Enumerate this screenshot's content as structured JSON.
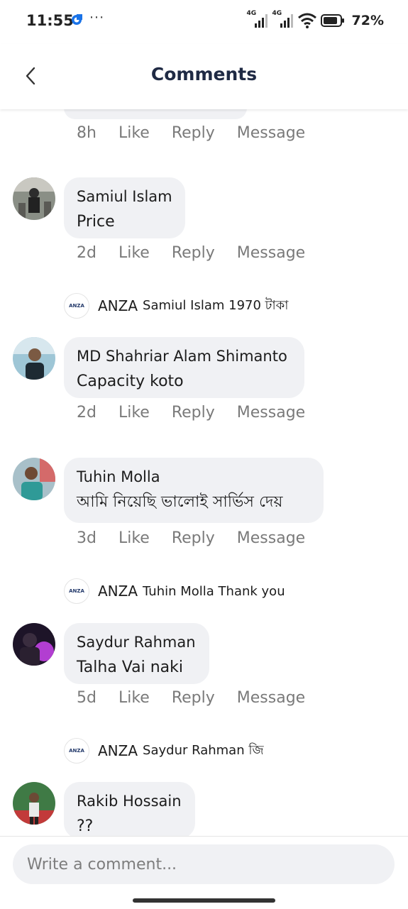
{
  "status_bar": {
    "time": "11:55",
    "dots": "···",
    "net1": "4G",
    "net2": "4G",
    "battery": "72%"
  },
  "header": {
    "title": "Comments"
  },
  "first_comment_meta": {
    "time": "8h",
    "like": "Like",
    "reply": "Reply",
    "message": "Message"
  },
  "comments": [
    {
      "name": "Samiul Islam",
      "text": "Price",
      "time": "2d",
      "like": "Like",
      "reply": "Reply",
      "message": "Message",
      "page_reply": {
        "page": "ANZA",
        "text": "Samiul Islam 1970 টাকা"
      }
    },
    {
      "name": "MD Shahriar Alam Shimanto",
      "text": "Capacity koto",
      "time": "2d",
      "like": "Like",
      "reply": "Reply",
      "message": "Message"
    },
    {
      "name": "Tuhin Molla",
      "text": "আমি নিয়েছি ভালোই সার্ভিস দেয়",
      "time": "3d",
      "like": "Like",
      "reply": "Reply",
      "message": "Message",
      "page_reply": {
        "page": "ANZA",
        "text": "Tuhin Molla Thank you"
      }
    },
    {
      "name": "Saydur Rahman",
      "text": "Talha Vai naki",
      "time": "5d",
      "like": "Like",
      "reply": "Reply",
      "message": "Message",
      "page_reply": {
        "page": "ANZA",
        "text": "Saydur Rahman জি"
      }
    },
    {
      "name": "Rakib Hossain",
      "text": "??"
    }
  ],
  "page_logo_text": "ANZA",
  "composer": {
    "placeholder": "Write a comment..."
  },
  "colors": {
    "bubble": "#f0f1f4",
    "meta_text": "#7a7a7a",
    "title": "#1f2a44",
    "logo": "#243a6b"
  }
}
